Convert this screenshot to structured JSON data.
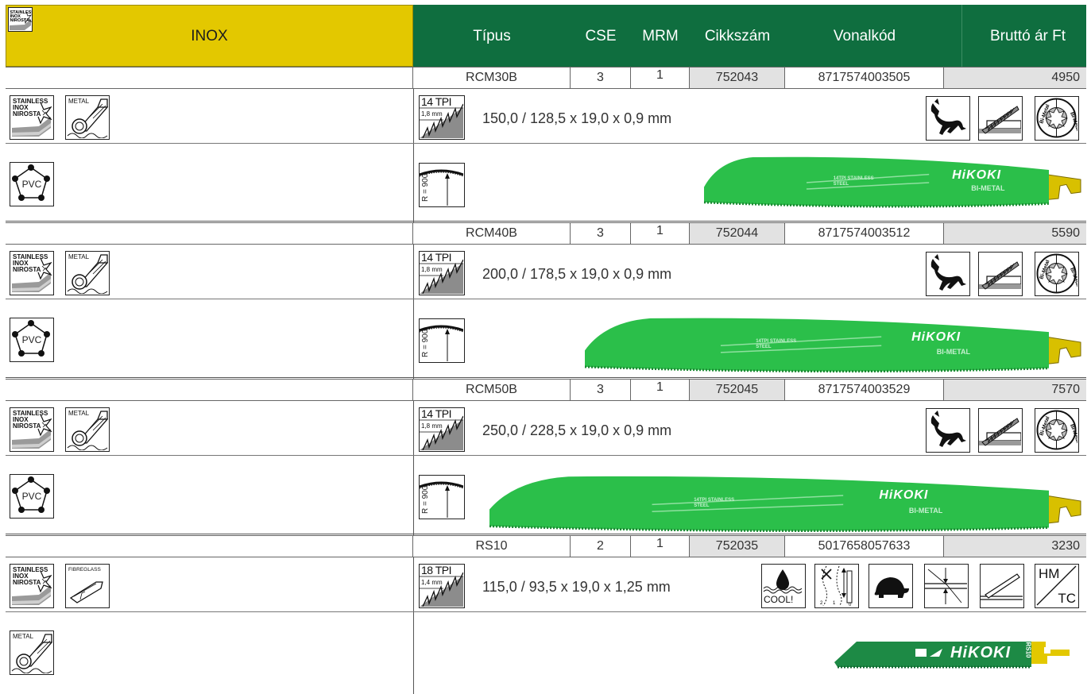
{
  "header": {
    "section_title": "INOX",
    "columns": [
      "Típus",
      "CSE",
      "MRM",
      "Cikkszám",
      "Vonalkód",
      "Bruttó ár Ft"
    ]
  },
  "icon_text": {
    "stainless": [
      "STAINLESS",
      "INOX",
      "NIROSTA"
    ],
    "metal": "METAL",
    "fibreglass": "FIBREGLASS",
    "pvc": "PVC",
    "radius": "R = 900",
    "cool": "COOL!",
    "hm_tc": [
      "HM",
      "TC"
    ],
    "bimetal": "Bi-Metal"
  },
  "products": [
    {
      "type": "RCM30B",
      "cse": "3",
      "mrm": "1",
      "article": "752043",
      "barcode": "8717574003505",
      "price": "4950",
      "tpi": "14 TPI",
      "tooth_mm": "1,8 mm",
      "dimensions": "150,0 / 128,5 x 19,0 x 0,9 mm",
      "blade_brand": "HiKOKI",
      "blade_sub": "BI-METAL",
      "blade_small": "14TPI STAINLESS STEEL"
    },
    {
      "type": "RCM40B",
      "cse": "3",
      "mrm": "1",
      "article": "752044",
      "barcode": "8717574003512",
      "price": "5590",
      "tpi": "14 TPI",
      "tooth_mm": "1,8 mm",
      "dimensions": "200,0 / 178,5 x 19,0 x 0,9 mm",
      "blade_brand": "HiKOKI",
      "blade_sub": "BI-METAL",
      "blade_small": "14TPI STAINLESS STEEL"
    },
    {
      "type": "RCM50B",
      "cse": "3",
      "mrm": "1",
      "article": "752045",
      "barcode": "8717574003529",
      "price": "7570",
      "tpi": "14 TPI",
      "tooth_mm": "1,8 mm",
      "dimensions": "250,0 / 228,5 x 19,0 x 0,9 mm",
      "blade_brand": "HiKOKI",
      "blade_sub": "BI-METAL",
      "blade_small": "14TPI STAINLESS STEEL"
    },
    {
      "type": "RS10",
      "cse": "2",
      "mrm": "1",
      "article": "752035",
      "barcode": "5017658057633",
      "price": "3230",
      "tpi": "18 TPI",
      "tooth_mm": "1,4 mm",
      "dimensions": "115,0 / 93,5 x 19,0 x 1,25 mm",
      "blade_brand": "HiKOKI",
      "blade_code": "RS10"
    }
  ]
}
